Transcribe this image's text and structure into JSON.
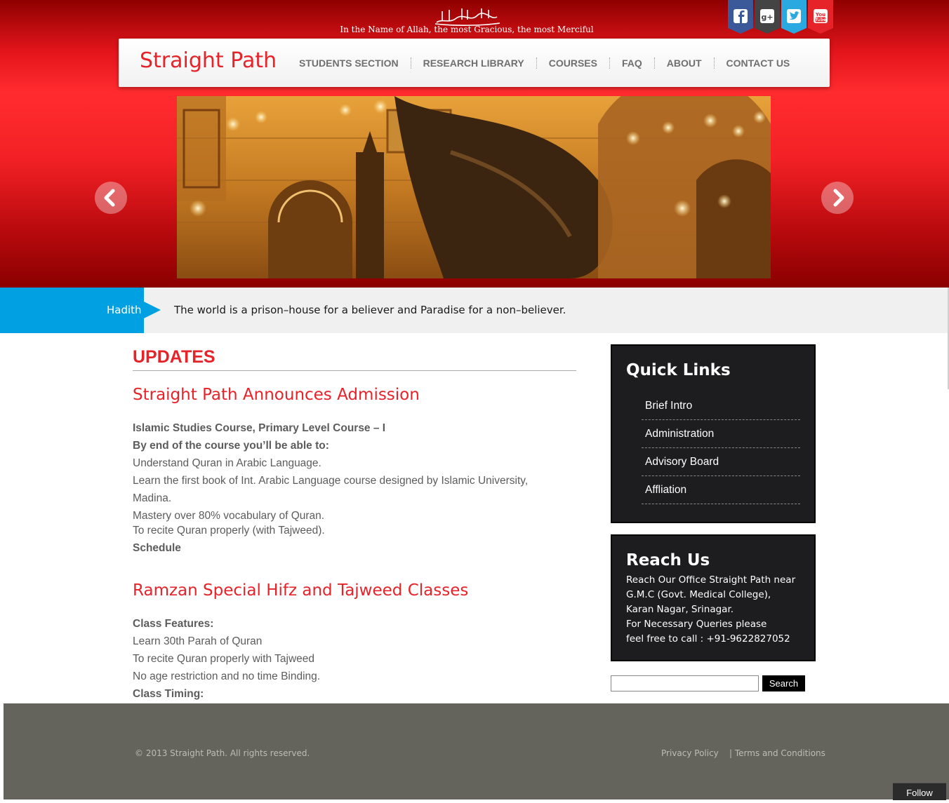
{
  "header": {
    "tagline": "In the Name of Allah, the most Gracious, the most Merciful",
    "logo": "Straight Path",
    "nav": [
      "STUDENTS SECTION",
      "RESEARCH LIBRARY",
      "COURSES",
      "FAQ",
      "ABOUT",
      "CONTACT US"
    ],
    "social": [
      "facebook-icon",
      "google-plus-icon",
      "twitter-icon",
      "youtube-icon"
    ],
    "social_colors": [
      "#3b5998",
      "#4a4a4a",
      "#2aa9e0",
      "#e7232a"
    ]
  },
  "slider": {
    "image": "mosque-interior-photo"
  },
  "hadith": {
    "label": "Hadith",
    "text": "The world is a prison–house for a believer and Paradise for a non–believer."
  },
  "updates": {
    "heading": "UPDATES",
    "posts": [
      {
        "title": "Straight Path Announces Admission",
        "lines": [
          "Islamic Studies Course, Primary Level Course – I",
          "By end of the course you’ll be able to:",
          "Understand Quran in Arabic Language.",
          "Learn the first book of Int. Arabic Language course designed by Islamic University,",
          "Madina.",
          "Mastery over 80% vocabulary of Quran.",
          "To recite Quran properly (with Tajweed).",
          "Schedule"
        ]
      },
      {
        "title": "Ramzan Special Hifz and Tajweed Classes",
        "lines": [
          "Class Features:",
          "Learn 30th Parah of Quran",
          "To recite Quran properly with Tajweed",
          "No age restriction and no time Binding.",
          "Class Timing:"
        ]
      }
    ]
  },
  "sidebar": {
    "quick_links": {
      "title": "Quick Links",
      "items": [
        "Brief Intro",
        "Administration",
        "Advisory Board",
        "Affliation"
      ]
    },
    "reach_us": {
      "title": "Reach Us",
      "lines": [
        "Reach Our Office Straight Path near",
        "G.M.C (Govt. Medical College),",
        "Karan Nagar, Srinagar.",
        "For Necessary Queries please",
        "feel free to call : +91-9622827052"
      ]
    },
    "search": {
      "button": "Search",
      "value": ""
    }
  },
  "footer": {
    "copyright": "© 2013 Straight Path. All rights reserved.",
    "links": [
      "Privacy Policy",
      "| Terms and Conditions"
    ],
    "follow": "Follow"
  }
}
